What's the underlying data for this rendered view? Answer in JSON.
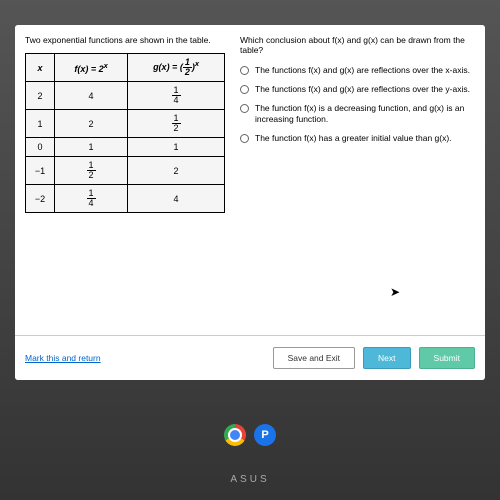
{
  "prompt": "Two exponential functions are shown in the table.",
  "question": "Which conclusion about f(x) and g(x) can be drawn from the table?",
  "table": {
    "headers": {
      "x": "x",
      "fx": "f(x) = 2",
      "fx_sup": "x",
      "gx_base": "g(x) = ",
      "gx_sup": "x"
    },
    "rows": [
      {
        "x": "2",
        "f": "4",
        "g_n": "1",
        "g_d": "4"
      },
      {
        "x": "1",
        "f": "2",
        "g_n": "1",
        "g_d": "2"
      },
      {
        "x": "0",
        "f": "1",
        "g": "1"
      },
      {
        "x": "−1",
        "f_n": "1",
        "f_d": "2",
        "g": "2"
      },
      {
        "x": "−2",
        "f_n": "1",
        "f_d": "4",
        "g": "4"
      }
    ]
  },
  "options": {
    "a": "The functions f(x) and g(x) are reflections over the x-axis.",
    "b": "The functions f(x) and g(x) are reflections over the y-axis.",
    "c": "The function f(x) is a decreasing function, and g(x) is an increasing function.",
    "d": "The function f(x) has a greater initial value than g(x)."
  },
  "footer": {
    "link": "Mark this and return",
    "save": "Save and Exit",
    "next": "Next",
    "submit": "Submit"
  },
  "taskbar": {
    "app2_letter": "P"
  },
  "brand": "ASUS"
}
